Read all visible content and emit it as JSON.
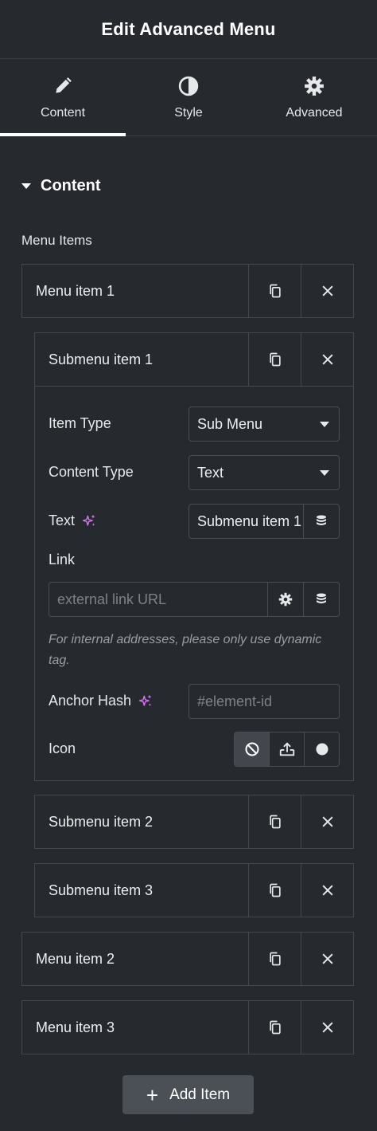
{
  "header": {
    "title": "Edit Advanced Menu"
  },
  "tabs": [
    {
      "label": "Content",
      "icon": "pencil-icon",
      "active": true
    },
    {
      "label": "Style",
      "icon": "contrast-icon",
      "active": false
    },
    {
      "label": "Advanced",
      "icon": "gear-icon",
      "active": false
    }
  ],
  "section": {
    "title": "Content"
  },
  "menu_items_label": "Menu Items",
  "items": {
    "menu1": "Menu item 1",
    "sub1": "Submenu item 1",
    "sub2": "Submenu item 2",
    "sub3": "Submenu item 3",
    "menu2": "Menu item 2",
    "menu3": "Menu item 3"
  },
  "form": {
    "item_type_label": "Item Type",
    "item_type_value": "Sub Menu",
    "content_type_label": "Content Type",
    "content_type_value": "Text",
    "text_label": "Text",
    "text_value": "Submenu item 1",
    "link_label": "Link",
    "link_placeholder": "external link URL",
    "link_help": "For internal addresses, please only use dynamic tag.",
    "anchor_label": "Anchor Hash",
    "anchor_placeholder": "#element-id",
    "icon_label": "Icon"
  },
  "add_button": {
    "label": "Add Item"
  },
  "colors": {
    "background": "#26292e",
    "border": "#44474d",
    "ai_sparkle": "#d57cf0",
    "button": "#4b5057"
  }
}
